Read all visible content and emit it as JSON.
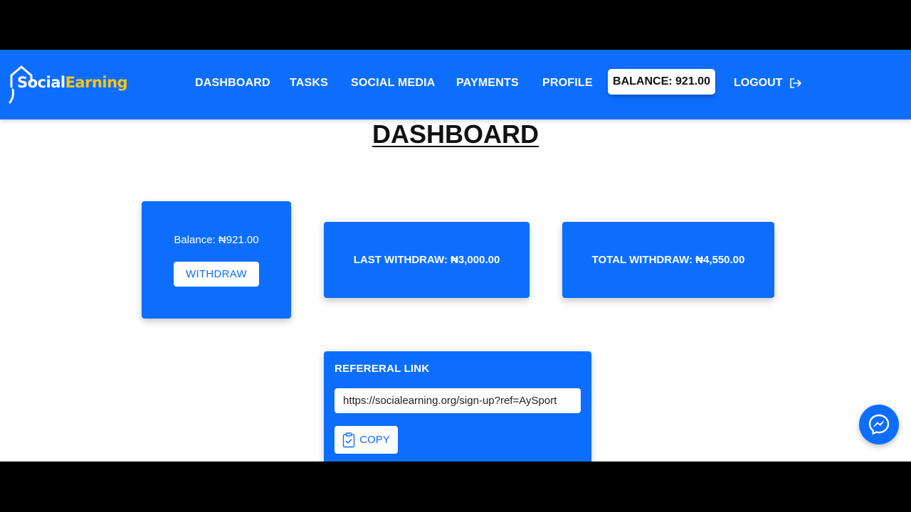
{
  "brand": {
    "logo_part1": "Social",
    "logo_part2": "Earning",
    "colors": {
      "primary": "#0d6efd",
      "logo_accent": "#f5c518"
    }
  },
  "nav": {
    "items": [
      {
        "label": "DASHBOARD"
      },
      {
        "label": "TASKS"
      },
      {
        "label": "SOCIAL MEDIA"
      },
      {
        "label": "PAYMENTS"
      },
      {
        "label": "PROFILE"
      }
    ],
    "balance_label": "BALANCE: 921.00",
    "logout_label": "LOGOUT",
    "logout_icon": "logout-icon"
  },
  "page": {
    "title": "DASHBOARD"
  },
  "cards": {
    "balance_text": "Balance: ₦921.00",
    "withdraw_button": "WITHDRAW",
    "last_withdraw": "LAST WITHDRAW: ₦3,000.00",
    "total_withdraw": "TOTAL WITHDRAW: ₦4,550.00"
  },
  "referral": {
    "title": "REFERERAL LINK",
    "link_value": "https://socialearning.org/sign-up?ref=AySport",
    "copy_label": "COPY",
    "copy_icon": "clipboard-check-icon"
  },
  "chat": {
    "icon": "messenger-icon"
  }
}
